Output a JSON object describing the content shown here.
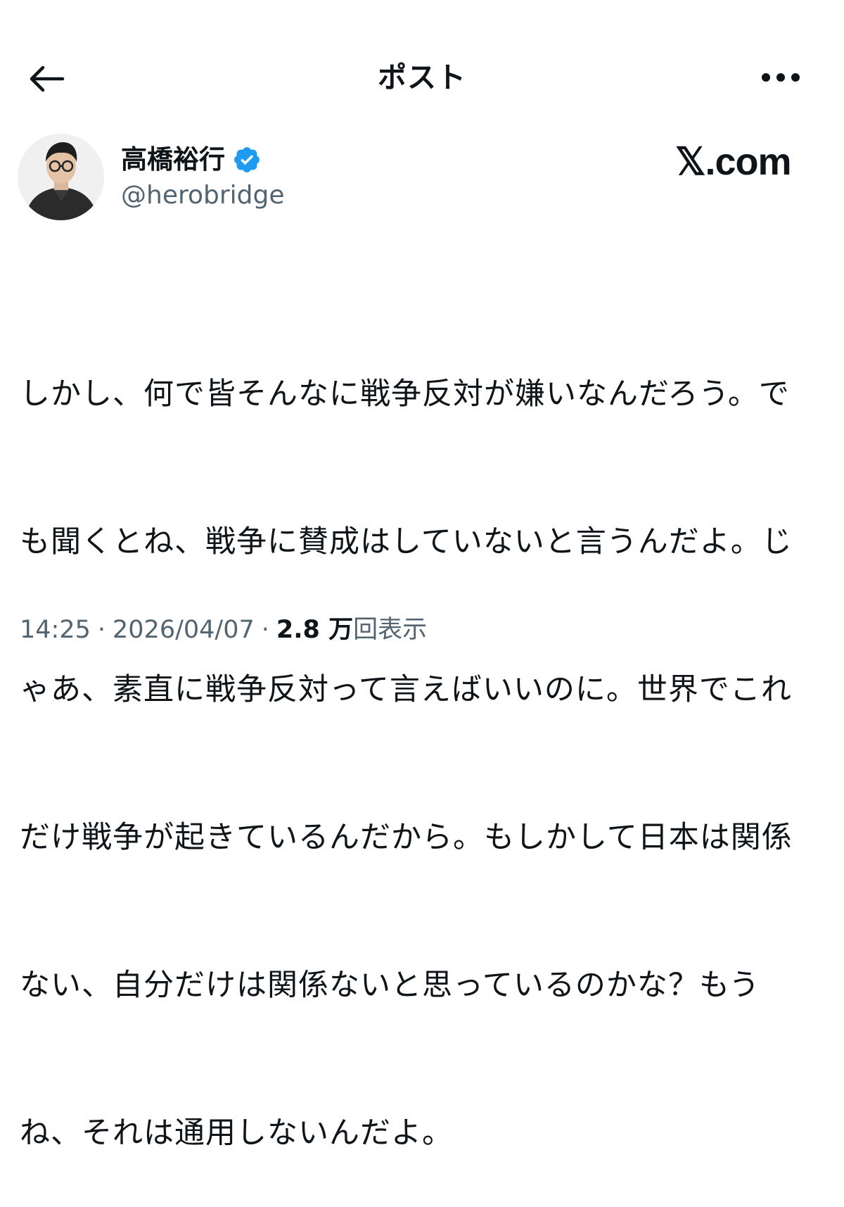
{
  "header": {
    "title": "ポスト"
  },
  "author": {
    "name": "高橋裕行",
    "handle": "@herobridge",
    "verified": true
  },
  "brand": {
    "text": "𝕏.com"
  },
  "post": {
    "lines": [
      "しかし、何で皆そんなに戦争反対が嫌いなんだろう。で",
      "も聞くとね、戦争に賛成はしていないと言うんだよ。じ",
      "ゃあ、素直に戦争反対って言えばいいのに。世界でこれ",
      "だけ戦争が起きているんだから。もしかして日本は関係",
      "ない、自分だけは関係ないと思っているのかな？もう",
      "ね、それは通用しないんだよ。"
    ]
  },
  "meta": {
    "time": "14:25",
    "separator": "·",
    "date": "2026/04/07",
    "views_count": "2.8 万",
    "views_label": "回表示"
  },
  "icons": {
    "back": "back-arrow-icon",
    "more": "more-horizontal-icon",
    "verified": "verified-badge-icon"
  },
  "colors": {
    "text_primary": "#0f1419",
    "text_secondary": "#536471",
    "verified_blue": "#1d9bf0",
    "background": "#ffffff"
  }
}
